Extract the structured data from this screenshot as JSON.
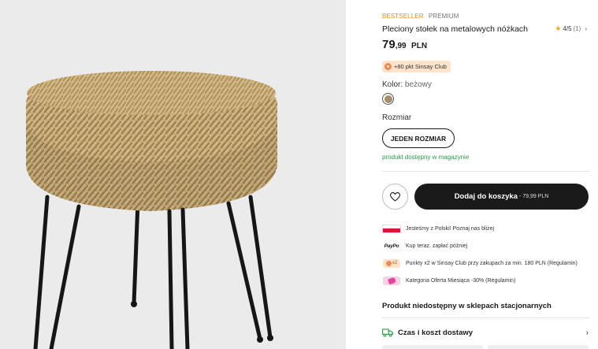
{
  "colors": {
    "accent_orange": "#e8891b",
    "available_green": "#2a9d4b",
    "button_dark": "#1a1a1a",
    "club_badge_bg": "#fde3c9",
    "swatch_beige": "#a68f6a"
  },
  "product_image": {
    "alt_icon": "wicker-stool-photo"
  },
  "product": {
    "tag_bestseller": "BESTSELLER",
    "tag_premium": "PREMIUM",
    "title": "Pleciony stołek na metalowych nóżkach",
    "rating": {
      "value": "4/5",
      "count": "(1)",
      "icon": "star-icon"
    },
    "price": {
      "integer": "79",
      "decimal": ",99",
      "currency": "PLN"
    },
    "club_badge": "+80 pkt Sinsay Club",
    "color_label": "Kolor:",
    "color_value": "beżowy",
    "size_label": "Rozmiar",
    "size_option": "JEDEN ROZMIAR",
    "availability": "produkt dostępny w magazynie"
  },
  "actions": {
    "wishlist_icon": "heart-icon",
    "add_to_cart": "Dodaj do koszyka",
    "add_to_cart_price": "- 79,99 PLN"
  },
  "info": [
    {
      "icon": "poland-flag-icon",
      "text": "Jesteśmy z Polski! Poznaj nas bliżej"
    },
    {
      "icon": "paypo-logo",
      "logo_text": "PayPo",
      "text": "Kup teraz, zapłać później"
    },
    {
      "icon": "club-x2-icon",
      "badge_text": "x2",
      "text": "Punkty x2 w Sinsay Club przy zakupach za min. 180 PLN (Regulamin)"
    },
    {
      "icon": "promo-tag-icon",
      "text": "Kategoria Oferta Miesiąca -30% (Regulamin)"
    }
  ],
  "store_availability": "Produkt niedostępny w sklepach stacjonarnych",
  "delivery": {
    "label": "Czas i koszt dostawy",
    "icon": "truck-icon"
  }
}
